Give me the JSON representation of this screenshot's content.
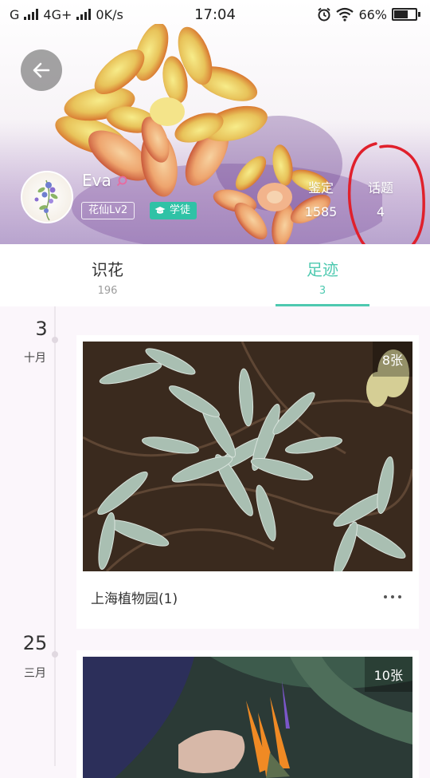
{
  "status_bar": {
    "carrier_1": "G",
    "carrier_2": "4G+",
    "speed": "0K/s",
    "time": "17:04",
    "battery_percent": "66%",
    "battery_level": 0.66
  },
  "profile": {
    "name": "Eva",
    "level_badge": "花仙Lv2",
    "role_badge": "学徒",
    "stats": [
      {
        "label": "鉴定",
        "value": "1585"
      },
      {
        "label": "话题",
        "value": "4"
      }
    ]
  },
  "tabs": [
    {
      "label": "识花",
      "count": "196"
    },
    {
      "label": "足迹",
      "count": "3"
    }
  ],
  "timeline": [
    {
      "day": "3",
      "month": "十月",
      "photo_count": "8张",
      "location": "上海植物园(1)"
    },
    {
      "day": "25",
      "month": "三月",
      "photo_count": "10张"
    }
  ],
  "colors": {
    "accent": "#4ec9b0",
    "role_badge_bg": "#2fc2a6",
    "annotation": "#e0202c"
  }
}
